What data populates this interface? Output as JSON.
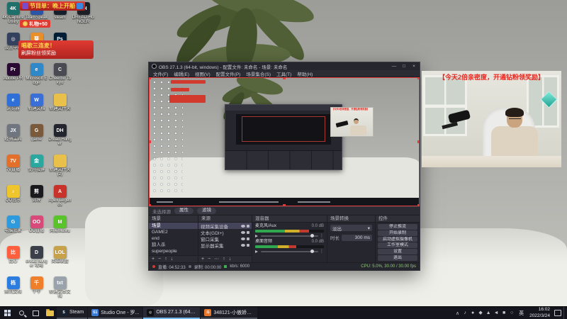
{
  "stream_overlay": {
    "schedule_banner": "节目单：晚上开船",
    "gift_banner": "礼物+50",
    "promo_line1": "唱歌三连麦！",
    "promo_line2": "刷屏粉丝领奖励"
  },
  "desktop_icons": [
    {
      "label": "4K Capture Utility",
      "glyph": "4K",
      "color": "#1f6f6b"
    },
    {
      "label": "设置中心",
      "glyph": "◎",
      "color": "#33415f"
    },
    {
      "label": "Adobe PR",
      "glyph": "Pr",
      "color": "#2a0a33"
    },
    {
      "label": "浏览器",
      "glyph": "e",
      "color": "#2f6fd8"
    },
    {
      "label": "经销工具",
      "glyph": "JX",
      "color": "#6f7680"
    },
    {
      "label": "7V直播",
      "glyph": "7V",
      "color": "#e2702a"
    },
    {
      "label": "QQ音乐",
      "glyph": "♪",
      "color": "#efc52e"
    },
    {
      "label": "电脑管家",
      "glyph": "G",
      "color": "#2e9ade"
    },
    {
      "label": "比心",
      "glyph": "比",
      "color": "#ff5f3c"
    },
    {
      "label": "腾讯文档",
      "glyph": "档",
      "color": "#2b7de0"
    },
    {
      "label": "TeamSpeak",
      "glyph": "TS",
      "color": "#2b56a8"
    },
    {
      "label": "向日葵",
      "glyph": "葵",
      "color": "#e88f2a"
    },
    {
      "label": "Microsoft Edge",
      "glyph": "e",
      "color": "#2f88c8"
    },
    {
      "label": "新建文档",
      "glyph": "W",
      "color": "#3a6fd8"
    },
    {
      "label": "game",
      "glyph": "G",
      "color": "#7a5a3a"
    },
    {
      "label": "金舟投屏",
      "glyph": "金",
      "color": "#2aa8a0"
    },
    {
      "label": "剪映",
      "glyph": "剪",
      "color": "#1a1a1e"
    },
    {
      "label": "OO直播",
      "glyph": "OO",
      "color": "#d84a7a"
    },
    {
      "label": "dread hunger 攻略",
      "glyph": "D",
      "color": "#3a3f4a"
    },
    {
      "label": "千牛",
      "glyph": "千",
      "color": "#ef7f2a"
    },
    {
      "label": "steam",
      "glyph": "S",
      "color": "#16202d"
    },
    {
      "label": "Photoshop",
      "glyph": "Ps",
      "color": "#001e36"
    },
    {
      "label": "Cheerbo Tokyo",
      "glyph": "C",
      "color": "#4a4a52"
    },
    {
      "label": "新建文件夹",
      "glyph": "",
      "color": "#e8c04a"
    },
    {
      "label": "Dread Hunger",
      "glyph": "DH",
      "color": "#23262e"
    },
    {
      "label": "新建文件夹 (2)",
      "glyph": "",
      "color": "#e8c04a"
    },
    {
      "label": "Apex Legends",
      "glyph": "A",
      "color": "#c8322a"
    },
    {
      "label": "网易MuMu",
      "glyph": "M",
      "color": "#58c42a"
    },
    {
      "label": "英雄联盟",
      "glyph": "LOL",
      "color": "#c8a24a"
    },
    {
      "label": "新建文本文档",
      "glyph": "txt",
      "color": "#9aa2ac"
    },
    {
      "label": "DREAD HUNGER",
      "glyph": "DH",
      "color": "#1c2026"
    }
  ],
  "obs": {
    "title": "OBS 27.1.3 (64-bit, windows) - 配置文件: 未命名 - 场景: 未命名",
    "window_controls": [
      {
        "name": "minimize",
        "glyph": "—"
      },
      {
        "name": "maximize",
        "glyph": "□"
      },
      {
        "name": "close",
        "glyph": "×"
      }
    ],
    "menu": [
      "文件(F)",
      "编辑(E)",
      "视图(V)",
      "配置文件(P)",
      "场景集合(S)",
      "工具(T)",
      "帮助(H)"
    ],
    "source_toolbar": {
      "no_source": "未选择源",
      "properties": "属性",
      "filters": "滤镜"
    },
    "docks": {
      "scenes": {
        "title": "场景",
        "items": [
          "场景",
          "GAME2",
          "end",
          "狼人杀",
          "superpeople"
        ]
      },
      "sources": {
        "title": "来源",
        "items": [
          "视频采集设备",
          "文本(GDI+)",
          "窗口采集",
          "显示器采集"
        ]
      },
      "mixer": {
        "title": "混音器",
        "channels": [
          {
            "name": "麦克风/Aux",
            "db": "0.0 dB"
          },
          {
            "name": "桌面音频",
            "db": "0.0 dB"
          }
        ]
      },
      "transitions": {
        "title": "场景转换",
        "type": "淡出",
        "arrow": "▾",
        "duration_label": "时长",
        "duration": "300 ms"
      },
      "controls": {
        "title": "控件",
        "buttons": [
          "停止推流",
          "开始录制",
          "启动虚拟摄像机",
          "工作室模式",
          "设置",
          "退出"
        ]
      }
    },
    "list_toolbar": {
      "add": "+",
      "remove": "−",
      "gear": "⋯",
      "up": "↑",
      "down": "↓"
    },
    "status": {
      "live": "直播: 04:52:33",
      "rec": "录制: 00:00:00",
      "kbps": "kb/s: 6000",
      "cpu": "CPU: 5.0%, 30.00 / 30.00 fps"
    }
  },
  "webcam": {
    "banner": "【今天2倍亲密度，开通钻粉领奖励】"
  },
  "taskbar": {
    "apps": [
      {
        "label": "Steam",
        "glyph": "S",
        "color": "#17202e"
      },
      {
        "label": "Studio One - 罗...",
        "glyph": "S1",
        "color": "#3a7bd5"
      },
      {
        "label": "OBS 27.1.3 (64-bi...",
        "glyph": "◎",
        "color": "#101014"
      },
      {
        "label": "348121-小傲娇的...",
        "glyph": "斗",
        "color": "#e8762a"
      }
    ],
    "tray_expand": "∧",
    "tray": [
      {
        "name": "music",
        "glyph": "♪"
      },
      {
        "name": "security",
        "glyph": "●"
      },
      {
        "name": "cloud",
        "glyph": "◆"
      },
      {
        "name": "gpu",
        "glyph": "▲"
      },
      {
        "name": "volume",
        "glyph": "◄"
      },
      {
        "name": "network",
        "glyph": "■"
      },
      {
        "name": "update",
        "glyph": "○"
      }
    ],
    "ime": "英",
    "time": "16:02",
    "date": "2022/3/24"
  }
}
